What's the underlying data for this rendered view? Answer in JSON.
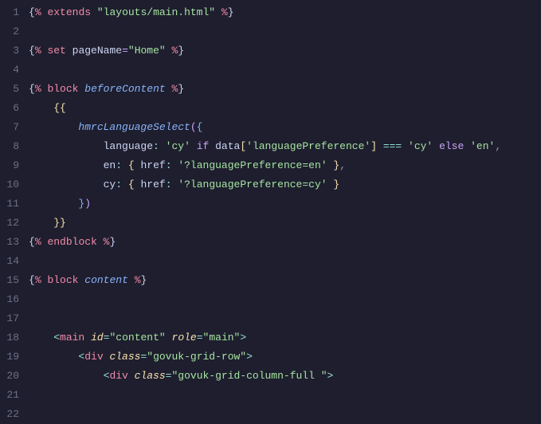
{
  "lines": [
    {
      "n": "1",
      "html": "<span class='delim'>{</span><span class='kw-tag'>%</span> <span class='kw-tag'>extends</span> <span class='str'>\"layouts/main.html\"</span> <span class='kw-tag'>%</span><span class='delim'>}</span>"
    },
    {
      "n": "2",
      "html": ""
    },
    {
      "n": "3",
      "html": "<span class='delim'>{</span><span class='kw-tag'>%</span> <span class='kw-tag'>set</span> <span class='prop'>pageName</span><span class='eq'>=</span><span class='str'>\"Home\"</span> <span class='kw-tag'>%</span><span class='delim'>}</span>"
    },
    {
      "n": "4",
      "html": ""
    },
    {
      "n": "5",
      "html": "<span class='delim'>{</span><span class='kw-tag'>%</span> <span class='kw-tag'>block</span> <span class='fn'>beforeContent</span> <span class='kw-tag'>%</span><span class='delim'>}</span>"
    },
    {
      "n": "6",
      "html": "    <span class='brace-y'>{{</span>"
    },
    {
      "n": "7",
      "html": "        <span class='fn'>hmrcLanguageSelect</span><span class='brace-p'>(</span><span class='brace-b'>{</span>"
    },
    {
      "n": "8",
      "html": "            <span class='prop'>language</span><span class='op'>:</span> <span class='str'>'cy'</span> <span class='kw-ctrl'>if</span> <span class='prop'>data</span><span class='brace-y'>[</span><span class='str'>'languagePreference'</span><span class='brace-y'>]</span> <span class='op'>===</span> <span class='str'>'cy'</span> <span class='kw-ctrl'>else</span> <span class='str'>'en'</span><span class='punct'>,</span>"
    },
    {
      "n": "9",
      "html": "            <span class='prop'>en</span><span class='op'>:</span> <span class='brace-y'>{</span> <span class='prop'>href</span><span class='op'>:</span> <span class='str'>'?languagePreference=en'</span> <span class='brace-y'>}</span><span class='punct'>,</span>"
    },
    {
      "n": "10",
      "html": "            <span class='prop'>cy</span><span class='op'>:</span> <span class='brace-y'>{</span> <span class='prop'>href</span><span class='op'>:</span> <span class='str'>'?languagePreference=cy'</span> <span class='brace-y'>}</span>"
    },
    {
      "n": "11",
      "html": "        <span class='brace-b'>}</span><span class='brace-p'>)</span>"
    },
    {
      "n": "12",
      "html": "    <span class='brace-y'>}}</span>"
    },
    {
      "n": "13",
      "html": "<span class='delim'>{</span><span class='kw-tag'>%</span> <span class='kw-tag'>endblock</span> <span class='kw-tag'>%</span><span class='delim'>}</span>"
    },
    {
      "n": "14",
      "html": ""
    },
    {
      "n": "15",
      "html": "<span class='delim'>{</span><span class='kw-tag'>%</span> <span class='kw-tag'>block</span> <span class='fn'>content</span> <span class='kw-tag'>%</span><span class='delim'>}</span>"
    },
    {
      "n": "16",
      "html": ""
    },
    {
      "n": "17",
      "html": ""
    },
    {
      "n": "18",
      "html": "    <span class='anglebr'>&lt;</span><span class='tagname'>main</span> <span class='attr'>id</span><span class='op'>=</span><span class='str'>\"content\"</span> <span class='attr'>role</span><span class='op'>=</span><span class='str'>\"main\"</span><span class='anglebr'>&gt;</span>"
    },
    {
      "n": "19",
      "html": "        <span class='anglebr'>&lt;</span><span class='tagname'>div</span> <span class='attr'>class</span><span class='op'>=</span><span class='str'>\"govuk-grid-row\"</span><span class='anglebr'>&gt;</span>"
    },
    {
      "n": "20",
      "html": "            <span class='anglebr'>&lt;</span><span class='tagname'>div</span> <span class='attr'>class</span><span class='op'>=</span><span class='str'>\"govuk-grid-column-full \"</span><span class='anglebr'>&gt;</span>"
    },
    {
      "n": "21",
      "html": ""
    },
    {
      "n": "22",
      "html": ""
    }
  ]
}
